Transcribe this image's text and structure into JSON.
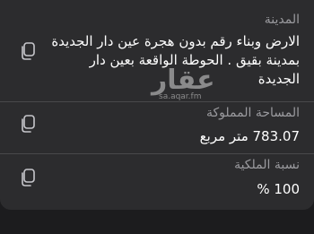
{
  "fields": [
    {
      "label": "المدينة",
      "value": "الارض وبناء  رقم بدون هجرة عين دار الجديدة  بمدينة بقيق . الحوطة الواقعة بعين دار الجديدة",
      "copy_icon": "copy-icon"
    },
    {
      "label": "المساحة المملوكة",
      "value": "783.07 متر مربع",
      "copy_icon": "copy-icon"
    },
    {
      "label": "نسبة الملكية",
      "value": "100 %",
      "copy_icon": "copy-icon"
    }
  ],
  "watermark": {
    "logo": "عقار",
    "site": "sa.aqar.fm"
  },
  "colors": {
    "background": "#1c1c1e",
    "card": "#2c2c2e",
    "label": "#9a9a9e",
    "value": "#ffffff",
    "divider": "#48484a"
  }
}
